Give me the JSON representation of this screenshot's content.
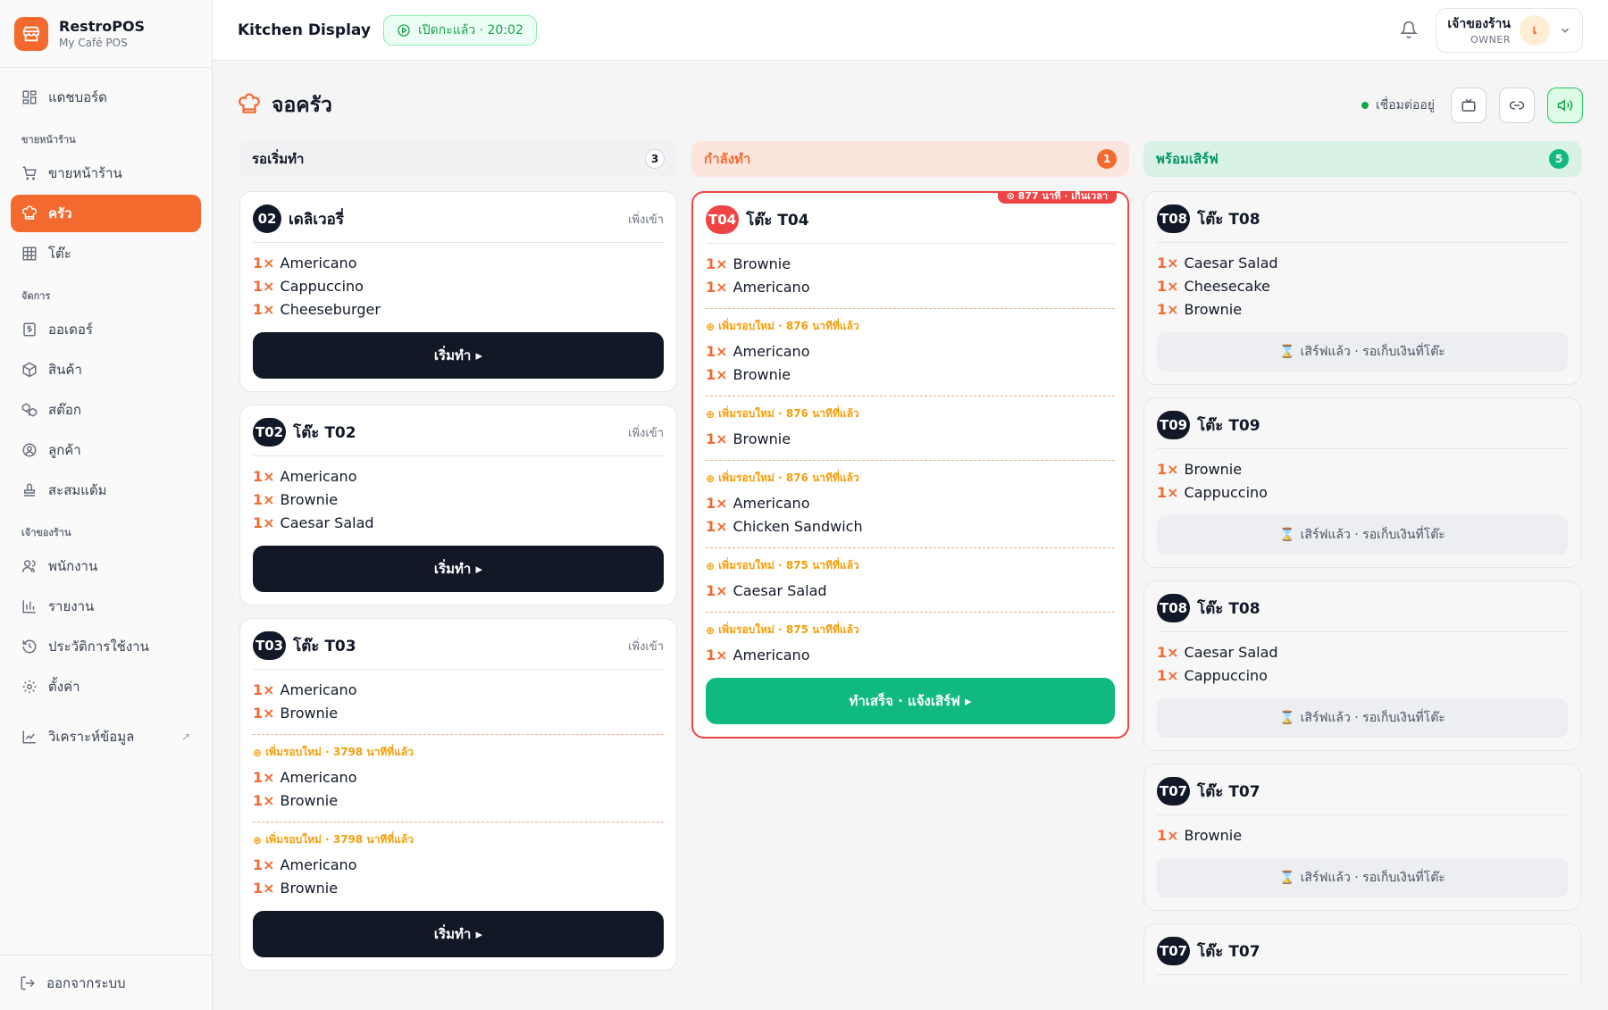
{
  "brand": {
    "name": "RestroPOS",
    "sub": "My Café POS"
  },
  "sidebar": {
    "dashboard": "แดชบอร์ด",
    "section_front": "ขายหน้าร้าน",
    "pos": "ขายหน้าร้าน",
    "kitchen": "ครัว",
    "tables": "โต๊ะ",
    "section_manage": "จัดการ",
    "orders": "ออเดอร์",
    "products": "สินค้า",
    "stock": "สต๊อก",
    "customers": "ลูกค้า",
    "points": "สะสมแต้ม",
    "section_owner": "เจ้าของร้าน",
    "staff": "พนักงาน",
    "reports": "รายงาน",
    "history": "ประวัติการใช้งาน",
    "settings": "ตั้งค่า",
    "analytics": "วิเคราะห์ข้อมูล",
    "analytics_ext": "↗",
    "logout": "ออกจากระบบ"
  },
  "topbar": {
    "title": "Kitchen Display",
    "shift_badge": "เปิดกะแล้ว · 20:02",
    "user_name": "เจ้าของร้าน",
    "user_role": "OWNER",
    "avatar_letter": "เ"
  },
  "page": {
    "title": "จอครัว",
    "connection": "เชื่อมต่ออยู่"
  },
  "columns": {
    "pending": {
      "label": "รอเริ่มทำ",
      "count": "3"
    },
    "cooking": {
      "label": "กำลังทำ",
      "count": "1"
    },
    "ready": {
      "label": "พร้อมเสิร์ฟ",
      "count": "5"
    }
  },
  "pending_cards": [
    {
      "badge": "02",
      "title": "เดลิเวอรี่",
      "meta": "เพิ่งเข้า",
      "items": [
        {
          "qty": "1×",
          "name": "Americano"
        },
        {
          "qty": "1×",
          "name": "Cappuccino"
        },
        {
          "qty": "1×",
          "name": "Cheeseburger"
        }
      ],
      "button": "เริ่มทำ ▸"
    },
    {
      "badge": "T02",
      "title": "โต๊ะ T02",
      "meta": "เพิ่งเข้า",
      "items": [
        {
          "qty": "1×",
          "name": "Americano"
        },
        {
          "qty": "1×",
          "name": "Brownie"
        },
        {
          "qty": "1×",
          "name": "Caesar Salad"
        }
      ],
      "button": "เริ่มทำ ▸"
    },
    {
      "badge": "T03",
      "title": "โต๊ะ T03",
      "meta": "เพิ่งเข้า",
      "items": [
        {
          "qty": "1×",
          "name": "Americano"
        },
        {
          "qty": "1×",
          "name": "Brownie"
        }
      ],
      "rounds": [
        {
          "label": "เพิ่มรอบใหม่ · 3798 นาทีที่แล้ว",
          "items": [
            {
              "qty": "1×",
              "name": "Americano"
            },
            {
              "qty": "1×",
              "name": "Brownie"
            }
          ]
        },
        {
          "label": "เพิ่มรอบใหม่ · 3798 นาทีที่แล้ว",
          "items": [
            {
              "qty": "1×",
              "name": "Americano"
            },
            {
              "qty": "1×",
              "name": "Brownie"
            }
          ]
        }
      ],
      "button": "เริ่มทำ ▸"
    }
  ],
  "cooking_card": {
    "late_tag": "⊙ 877 นาที · เกินเวลา",
    "badge": "T04",
    "title": "โต๊ะ T04",
    "items": [
      {
        "qty": "1×",
        "name": "Brownie"
      },
      {
        "qty": "1×",
        "name": "Americano"
      }
    ],
    "rounds": [
      {
        "label": "เพิ่มรอบใหม่ · 876 นาทีที่แล้ว",
        "items": [
          {
            "qty": "1×",
            "name": "Americano"
          },
          {
            "qty": "1×",
            "name": "Brownie"
          }
        ]
      },
      {
        "label": "เพิ่มรอบใหม่ · 876 นาทีที่แล้ว",
        "items": [
          {
            "qty": "1×",
            "name": "Brownie"
          }
        ]
      },
      {
        "label": "เพิ่มรอบใหม่ · 876 นาทีที่แล้ว",
        "items": [
          {
            "qty": "1×",
            "name": "Americano"
          },
          {
            "qty": "1×",
            "name": "Chicken Sandwich"
          }
        ]
      },
      {
        "label": "เพิ่มรอบใหม่ · 875 นาทีที่แล้ว",
        "items": [
          {
            "qty": "1×",
            "name": "Caesar Salad"
          }
        ]
      },
      {
        "label": "เพิ่มรอบใหม่ · 875 นาทีที่แล้ว",
        "items": [
          {
            "qty": "1×",
            "name": "Americano"
          }
        ]
      }
    ],
    "button": "ทำเสร็จ · แจ้งเสิร์ฟ ▸"
  },
  "ready_cards": [
    {
      "badge": "T08",
      "title": "โต๊ะ T08",
      "items": [
        {
          "qty": "1×",
          "name": "Caesar Salad"
        },
        {
          "qty": "1×",
          "name": "Cheesecake"
        },
        {
          "qty": "1×",
          "name": "Brownie"
        }
      ],
      "status": "เสิร์ฟแล้ว · รอเก็บเงินที่โต๊ะ"
    },
    {
      "badge": "T09",
      "title": "โต๊ะ T09",
      "items": [
        {
          "qty": "1×",
          "name": "Brownie"
        },
        {
          "qty": "1×",
          "name": "Cappuccino"
        }
      ],
      "status": "เสิร์ฟแล้ว · รอเก็บเงินที่โต๊ะ"
    },
    {
      "badge": "T08",
      "title": "โต๊ะ T08",
      "items": [
        {
          "qty": "1×",
          "name": "Caesar Salad"
        },
        {
          "qty": "1×",
          "name": "Cappuccino"
        }
      ],
      "status": "เสิร์ฟแล้ว · รอเก็บเงินที่โต๊ะ"
    },
    {
      "badge": "T07",
      "title": "โต๊ะ T07",
      "items": [
        {
          "qty": "1×",
          "name": "Brownie"
        }
      ],
      "status": "เสิร์ฟแล้ว · รอเก็บเงินที่โต๊ะ"
    },
    {
      "badge": "T07",
      "title": "โต๊ะ T07",
      "items": [],
      "status": ""
    }
  ]
}
